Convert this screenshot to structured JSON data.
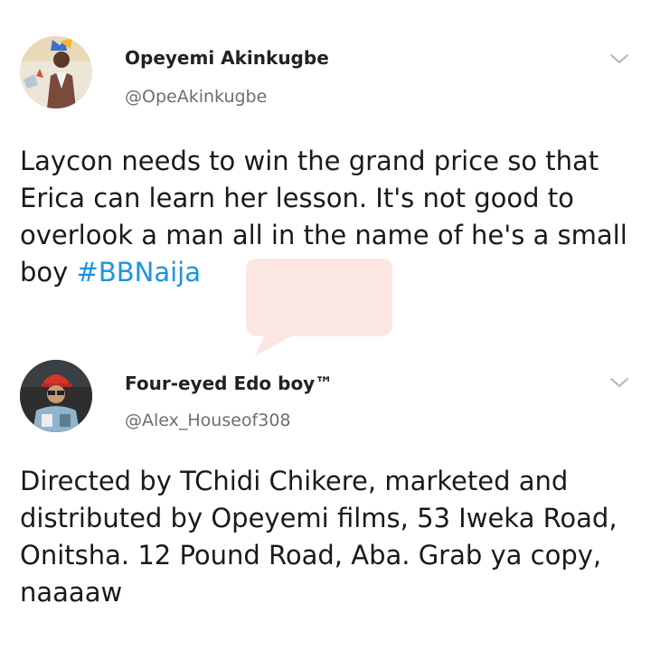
{
  "tweets": [
    {
      "display_name": "Opeyemi Akinkugbe",
      "handle": "@OpeAkinkugbe",
      "text": "Laycon needs to win the grand price so that Erica can learn her lesson. It's not good to overlook a man all in the name of he's a small boy ",
      "hashtag": "#BBNaija",
      "avatar_icon": "profile-photo",
      "menu_icon": "chevron-down-icon"
    },
    {
      "display_name": "Four-eyed Edo boy™",
      "handle": "@Alex_Houseof308",
      "text": "Directed by TChidi Chikere, marketed and distributed by Opeyemi films, 53 Iweka Road, Onitsha. 12 Pound Road, Aba. Grab ya copy, naaaaw",
      "avatar_icon": "profile-photo",
      "menu_icon": "chevron-down-icon"
    }
  ],
  "colors": {
    "hashtag": "#1c94e0",
    "handle": "#6e6e6e",
    "text": "#1a1a1a"
  }
}
